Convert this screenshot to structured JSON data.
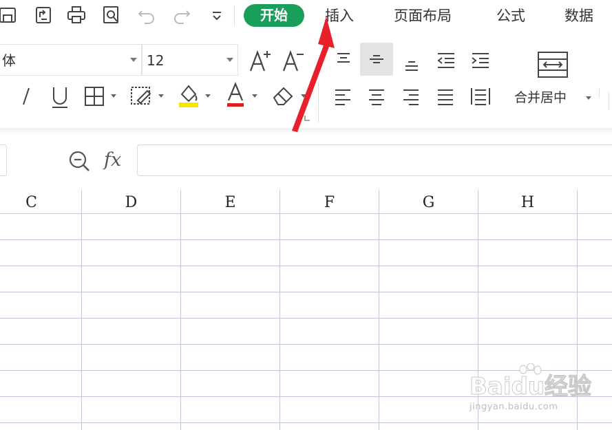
{
  "tabs": {
    "start": "开始",
    "insert": "插入",
    "page_layout": "页面布局",
    "formulas": "公式",
    "data": "数据"
  },
  "font": {
    "name_partial": "体",
    "size": "12"
  },
  "ribbon": {
    "merge_center_label": "合并居中",
    "font_color_accent": "#e02020",
    "highlight_accent": "#f5e600"
  },
  "formula_bar": {
    "fx_label": "fx",
    "content": ""
  },
  "columns": [
    "C",
    "D",
    "E",
    "F",
    "G",
    "H"
  ],
  "watermark": {
    "brand": "Baidu经验",
    "url": "jingyan.baidu.com"
  },
  "colors": {
    "start_tab_bg": "#1a9e5c",
    "arrow": "#e8202a",
    "gridline": "#c4c4dc"
  }
}
